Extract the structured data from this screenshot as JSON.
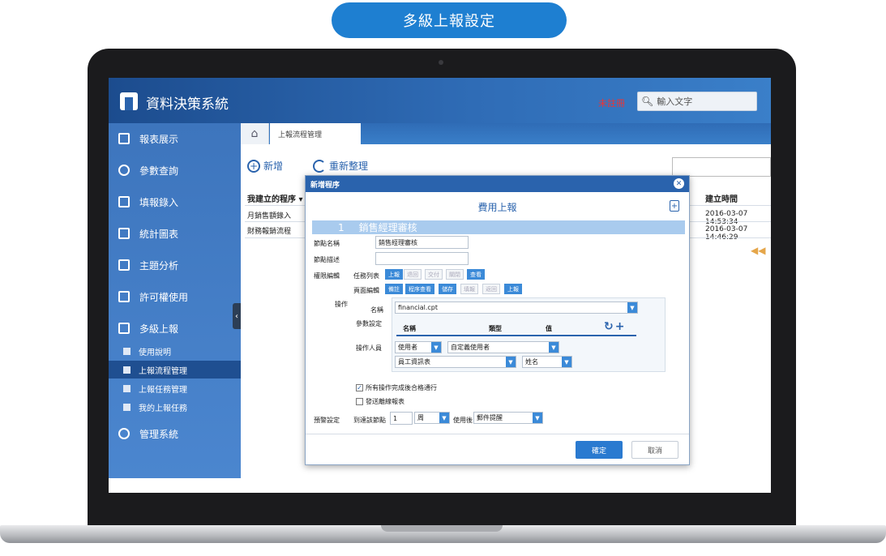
{
  "banner": {
    "title": "多級上報設定"
  },
  "app": {
    "title": "資料決策系統",
    "user_link": "未註冊",
    "search_placeholder": "輸入文字"
  },
  "sidebar": {
    "items": [
      {
        "label": "報表展示"
      },
      {
        "label": "參數查詢"
      },
      {
        "label": "填報錄入"
      },
      {
        "label": "統計圖表"
      },
      {
        "label": "主題分析"
      },
      {
        "label": "許可權使用"
      },
      {
        "label": "多級上報"
      },
      {
        "label": "管理系統"
      }
    ],
    "sub_items": [
      {
        "label": "使用說明"
      },
      {
        "label": "上報流程管理"
      },
      {
        "label": "上報任務管理"
      },
      {
        "label": "我的上報任務"
      }
    ]
  },
  "tabs": {
    "current": "上報流程管理"
  },
  "toolbar": {
    "add": "新增",
    "refresh": "重新整理"
  },
  "table": {
    "headers": {
      "process": "我建立的程序",
      "created": "建立時間"
    },
    "rows": [
      {
        "name": "月銷售額錄入",
        "time": "2016-03-07 14:53:34"
      },
      {
        "name": "財務報銷流程",
        "time": "2016-03-07 14:46:29"
      }
    ]
  },
  "dialog": {
    "title": "新增程序",
    "subtitle": "費用上報",
    "step_number": "1",
    "step_name": "銷售經理審核",
    "labels": {
      "node_name": "節點名稱",
      "node_desc": "節點描述",
      "permission": "權限編輯",
      "task_list": "任務列表",
      "page_edit": "頁面編輯",
      "operation": "操作",
      "name": "名稱",
      "params": "參數設定",
      "operator": "操作人員",
      "warning": "預警設定",
      "reach_node": "到達該節點",
      "after_use": "使用後"
    },
    "node_name_value": "銷售經理審核",
    "task_buttons": [
      "上報",
      "退回",
      "交付",
      "關閉",
      "查看"
    ],
    "page_buttons": [
      "備註",
      "程序查看",
      "儲存",
      "填報",
      "返回",
      "上報"
    ],
    "task_active": [
      true,
      false,
      false,
      false,
      true
    ],
    "page_active": [
      true,
      true,
      true,
      false,
      false,
      true
    ],
    "template_file": "financial.cpt",
    "param_headers": [
      "名稱",
      "類型",
      "值"
    ],
    "operator_type": "使用者",
    "operator_mode": "自定義使用者",
    "operator_table": "員工資訊表",
    "operator_field": "姓名",
    "check_all_done": "所有操作完成後合格通行",
    "check_offline": "發送離線報表",
    "warn_count": "1",
    "warn_unit": "周",
    "warn_method": "郵件提醒",
    "ok": "確定",
    "cancel": "取消"
  },
  "colors": {
    "accent": "#2a63ad",
    "sidebar": "#3d75bd",
    "banner": "#1e7fd1"
  }
}
